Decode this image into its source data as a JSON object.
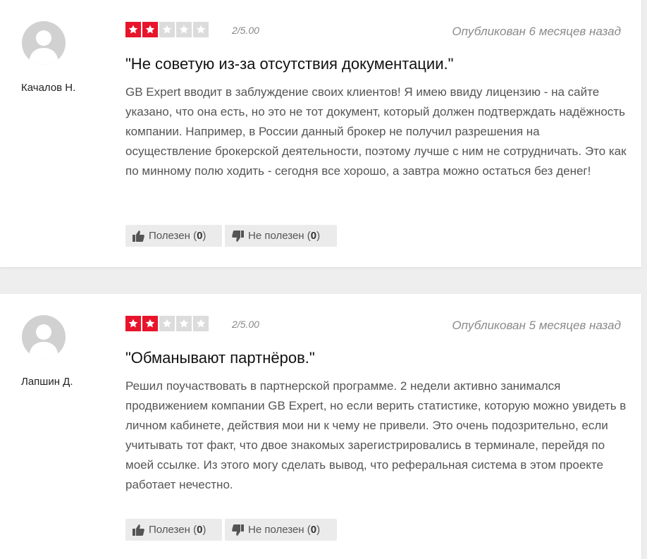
{
  "reviews": [
    {
      "author": "Качалов Н.",
      "rating_text": "2/5.00",
      "rating": 2,
      "max_rating": 5,
      "published": "Опубликован 6 месяцев назад",
      "title": "\"Не советую из-за отсутствия документации.\"",
      "text": "GB Expert вводит в заблуждение своих клиентов! Я имею ввиду лицензию - на сайте указано, что она есть, но это не тот документ, который должен подтверждать надёжность компании. Например, в России данный брокер не получил разрешения на осуществление брокерской деятельности, поэтому лучше с ним не сотрудничать. Это как по минному полю ходить - сегодня все хорошо, а завтра можно остаться без денег!",
      "helpful_label": "Полезен",
      "helpful_count": "0",
      "unhelpful_label": "Не полезен",
      "unhelpful_count": "0"
    },
    {
      "author": "Лапшин Д.",
      "rating_text": "2/5.00",
      "rating": 2,
      "max_rating": 5,
      "published": "Опубликован 5 месяцев назад",
      "title": "\"Обманывают партнёров.\"",
      "text": "Решил поучаствовать в партнерской программе. 2 недели активно занимался продвижением компании GB Expert, но если верить статистике, которую можно увидеть в личном кабинете, действия мои ни к чему не привели. Это очень подозрительно, если учитывать тот факт, что двое знакомых зарегистрировались в терминале, перейдя по моей ссылке. Из этого могу сделать вывод, что реферальная система в этом проекте работает нечестно.",
      "helpful_label": "Полезен",
      "helpful_count": "0",
      "unhelpful_label": "Не полезен",
      "unhelpful_count": "0"
    }
  ],
  "colors": {
    "star_on": "#e8142b",
    "star_off": "#dcdcdc"
  },
  "icons": {
    "helpful": "thumbs-up-icon",
    "unhelpful": "thumbs-down-icon",
    "avatar": "user-silhouette-icon",
    "star": "star-icon"
  }
}
